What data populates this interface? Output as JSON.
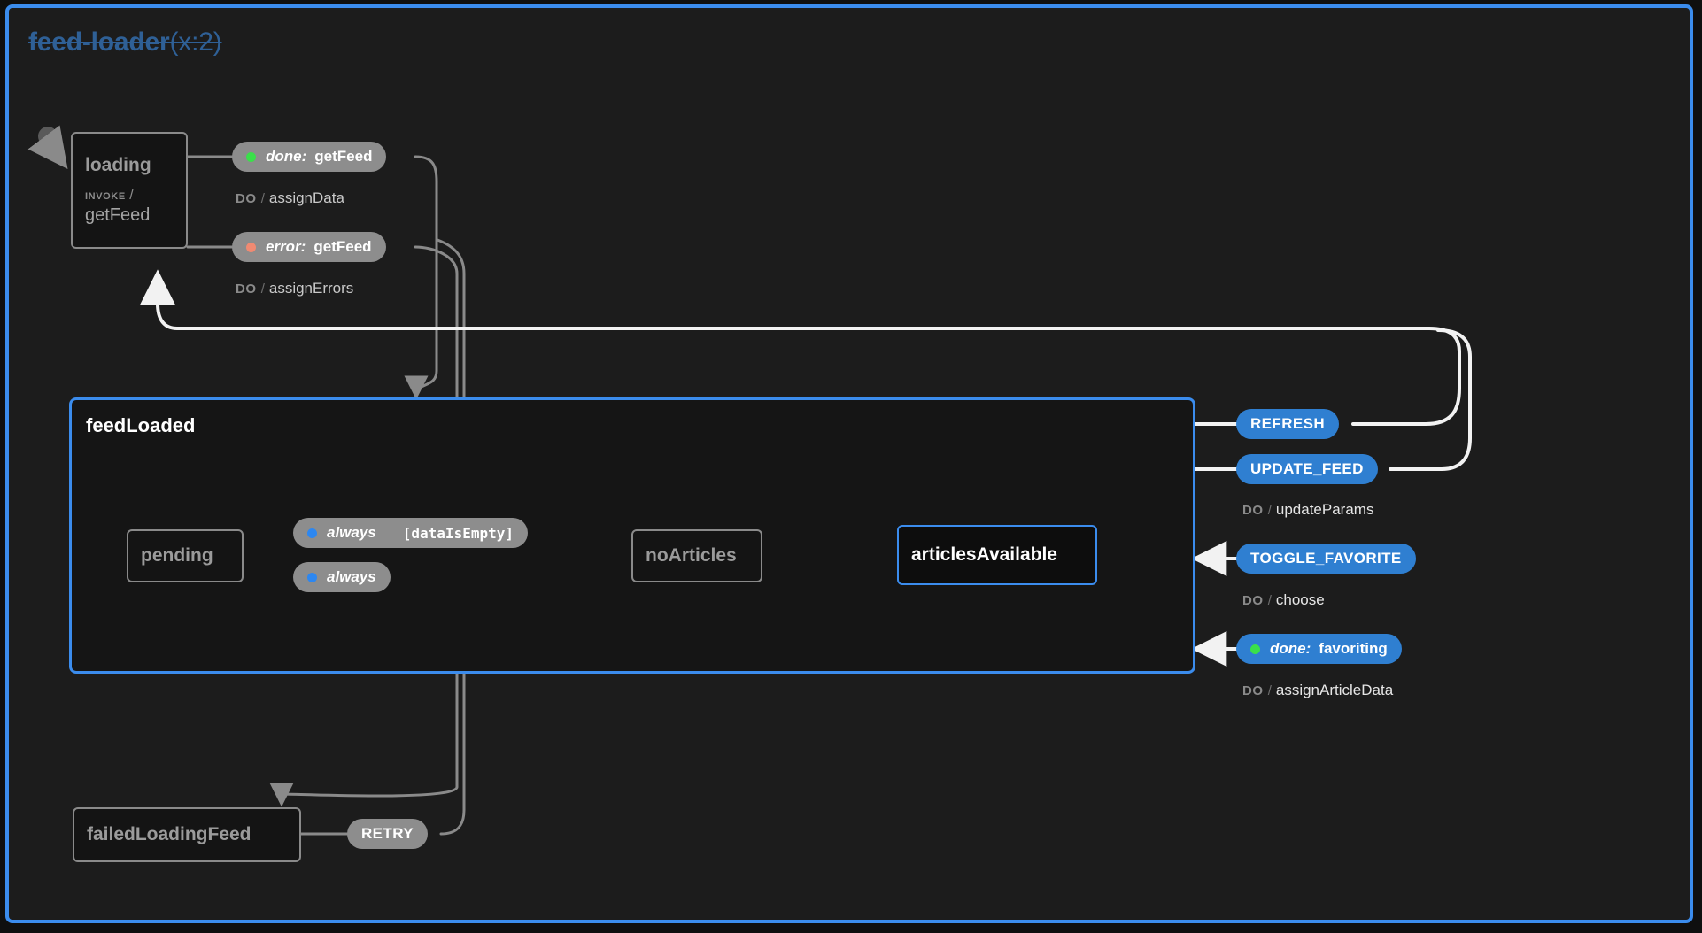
{
  "machine": {
    "title": "feed-loader",
    "context": "(x:2)",
    "border_color": "#3b8ced",
    "background": "#1c1c1c"
  },
  "colors": {
    "accent_blue": "#3b8ced",
    "pill_blue": "#2f7fd1",
    "pill_gray": "#8d8d8d",
    "state_border": "#8a8a8a",
    "done_dot": "#3ae04a",
    "error_dot": "#f08a72",
    "always_dot": "#2d87f0",
    "active_edge": "#ffffff",
    "idle_edge": "#8a8a8a",
    "title_blue": "#2f6096"
  },
  "states": [
    {
      "id": "loading",
      "label": "loading",
      "active": false,
      "invoke_keyword": "INVOKE",
      "invoke_slash": "/",
      "invoke_src": "getFeed"
    },
    {
      "id": "feedLoaded",
      "label": "feedLoaded",
      "active": true,
      "compound": true
    },
    {
      "id": "pending",
      "label": "pending",
      "active": false
    },
    {
      "id": "noArticles",
      "label": "noArticles",
      "active": false
    },
    {
      "id": "articlesAvailable",
      "label": "articlesAvailable",
      "active": true
    },
    {
      "id": "failedLoadingFeed",
      "label": "failedLoadingFeed",
      "active": false
    }
  ],
  "events": [
    {
      "id": "done-getFeed",
      "kind": "done",
      "dot": "green",
      "event": "done:",
      "target": "getFeed",
      "highlighted": false
    },
    {
      "id": "error-getFeed",
      "kind": "error",
      "dot": "red",
      "event": "error:",
      "target": "getFeed",
      "highlighted": false
    },
    {
      "id": "always-dataIsEmpty",
      "kind": "always",
      "dot": "blue",
      "event": "always",
      "guard": "[dataIsEmpty]",
      "highlighted": false
    },
    {
      "id": "always-plain",
      "kind": "always",
      "dot": "blue",
      "event": "always",
      "highlighted": false
    },
    {
      "id": "refresh",
      "kind": "event",
      "event": "REFRESH",
      "highlighted": true
    },
    {
      "id": "update-feed",
      "kind": "event",
      "event": "UPDATE_FEED",
      "highlighted": true
    },
    {
      "id": "toggle-favorite",
      "kind": "event",
      "event": "TOGGLE_FAVORITE",
      "highlighted": true
    },
    {
      "id": "done-favoriting",
      "kind": "done",
      "dot": "green",
      "event": "done:",
      "target": "favoriting",
      "highlighted": true
    },
    {
      "id": "retry",
      "kind": "event",
      "event": "RETRY",
      "highlighted": false
    }
  ],
  "actions": [
    {
      "id": "assign-data",
      "keyword": "DO",
      "slash": "/",
      "value": "assignData"
    },
    {
      "id": "assign-errors",
      "keyword": "DO",
      "slash": "/",
      "value": "assignErrors"
    },
    {
      "id": "update-params",
      "keyword": "DO",
      "slash": "/",
      "value": "updateParams"
    },
    {
      "id": "choose",
      "keyword": "DO",
      "slash": "/",
      "value": "choose"
    },
    {
      "id": "assign-article-data",
      "keyword": "DO",
      "slash": "/",
      "value": "assignArticleData"
    }
  ]
}
